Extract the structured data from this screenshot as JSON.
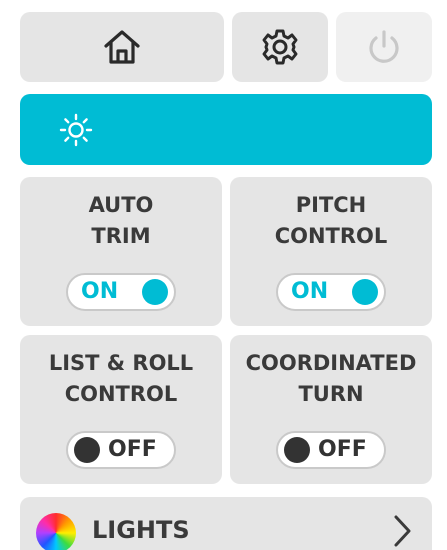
{
  "colors": {
    "accent": "#00bcd4",
    "tile_bg": "#e5e5e5",
    "text_dark": "#3a3a3a",
    "knob_on": "#00bcd4",
    "knob_off": "#333333",
    "power_disabled": "#c8c8c8"
  },
  "top_bar": {
    "home_icon": "home-icon",
    "settings_icon": "gear-icon",
    "power_icon": "power-icon",
    "power_state": "disabled"
  },
  "brightness_bar": {
    "icon": "sun-icon"
  },
  "controls": [
    {
      "line1": "AUTO",
      "line2": "TRIM",
      "state": "ON"
    },
    {
      "line1": "PITCH",
      "line2": "CONTROL",
      "state": "ON"
    },
    {
      "line1": "LIST & ROLL",
      "line2": "CONTROL",
      "state": "OFF"
    },
    {
      "line1": "COORDINATED",
      "line2": "TURN",
      "state": "OFF"
    }
  ],
  "lights": {
    "label": "LIGHTS",
    "icon": "color-wheel-icon",
    "chevron": "chevron-right-icon"
  }
}
